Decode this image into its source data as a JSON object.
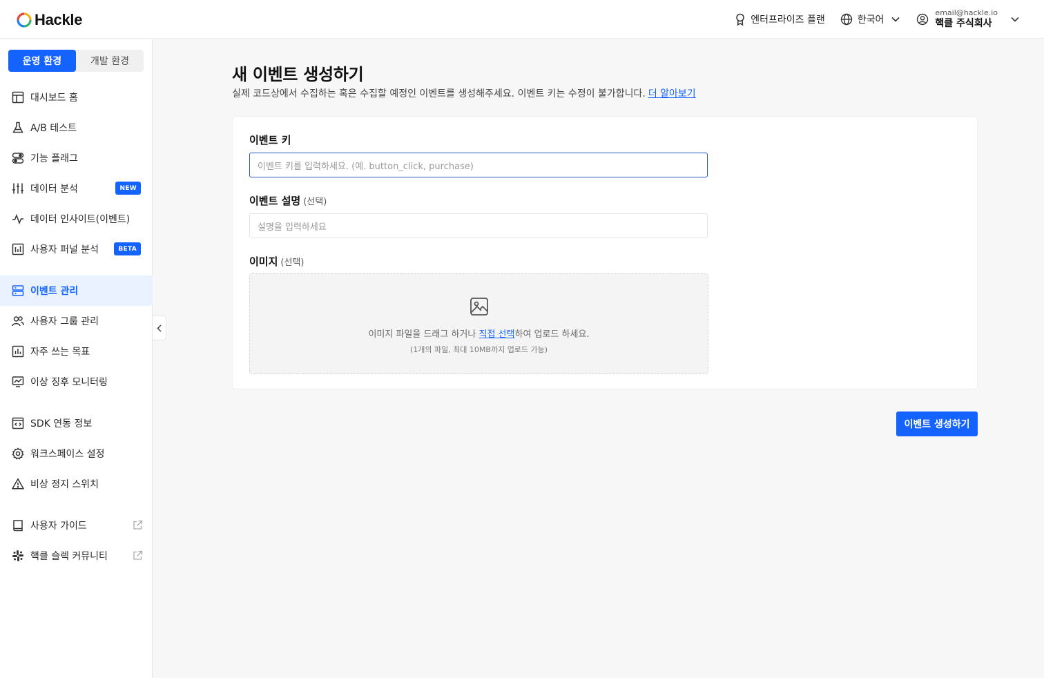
{
  "brand": {
    "name": "Hackle"
  },
  "header": {
    "plan_label": "엔터프라이즈 플랜",
    "language": "한국어",
    "account_email": "email@hackle.io",
    "account_org": "핵클 주식회사"
  },
  "sidebar": {
    "env_tabs": [
      {
        "label": "운영 환경",
        "active": true
      },
      {
        "label": "개발 환경",
        "active": false
      }
    ],
    "groups": [
      [
        {
          "label": "대시보드 홈",
          "icon": "dashboard-icon"
        },
        {
          "label": "A/B 테스트",
          "icon": "flask-icon"
        },
        {
          "label": "기능 플래그",
          "icon": "toggle-icon"
        },
        {
          "label": "데이터 분석",
          "icon": "sliders-icon",
          "badge": "NEW"
        },
        {
          "label": "데이터 인사이트(이벤트)",
          "icon": "pulse-icon"
        },
        {
          "label": "사용자 퍼널 분석",
          "icon": "bar-chart-icon",
          "badge": "BETA"
        }
      ],
      [
        {
          "label": "이벤트 관리",
          "icon": "server-icon",
          "active": true
        },
        {
          "label": "사용자 그룹 관리",
          "icon": "users-icon"
        },
        {
          "label": "자주 쓰는 목표",
          "icon": "bar-chart-icon"
        },
        {
          "label": "이상 징후 모니터링",
          "icon": "monitor-chart-icon"
        }
      ],
      [
        {
          "label": "SDK 연동 정보",
          "icon": "code-window-icon"
        },
        {
          "label": "워크스페이스 설정",
          "icon": "gear-icon"
        },
        {
          "label": "비상 정지 스위치",
          "icon": "warning-icon"
        }
      ],
      [
        {
          "label": "사용자 가이드",
          "icon": "book-icon",
          "external": true
        },
        {
          "label": "핵클 슬렉 커뮤니티",
          "icon": "slack-icon",
          "external": true
        }
      ]
    ]
  },
  "main": {
    "title": "새 이벤트 생성하기",
    "description": "실제 코드상에서 수집하는 혹은 수집할 예정인 이벤트를 생성해주세요. 이벤트 키는 수정이 불가합니다.",
    "learn_more": "더 알아보기",
    "event_key": {
      "label": "이벤트 키",
      "placeholder": "이벤트 키를 입력하세요. (예. button_click, purchase)"
    },
    "event_desc": {
      "label": "이벤트 설명",
      "optional": "(선택)",
      "placeholder": "설명을 입력하세요"
    },
    "image": {
      "label": "이미지",
      "optional": "(선택)",
      "drop_text_before": "이미지 파일을 드래그 하거나 ",
      "drop_link": "직접 선택",
      "drop_text_after": "하여 업로드 하세요.",
      "drop_sub": "(1개의 파일, 최대 10MB까지 업로드 가능)"
    },
    "submit_label": "이벤트 생성하기"
  },
  "colors": {
    "accent": "#1463ff",
    "active_bg": "#eaf1ff"
  }
}
